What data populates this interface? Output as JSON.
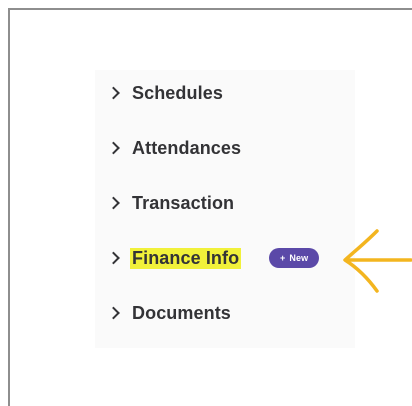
{
  "menu": {
    "items": [
      {
        "label": "Schedules",
        "icon": "chevron-right-icon"
      },
      {
        "label": "Attendances",
        "icon": "chevron-right-icon"
      },
      {
        "label": "Transaction",
        "icon": "chevron-right-icon"
      },
      {
        "label": "Finance Info",
        "icon": "chevron-right-icon",
        "highlighted": true,
        "badge": {
          "plus": "+",
          "text": "New"
        }
      },
      {
        "label": "Documents",
        "icon": "chevron-right-icon"
      }
    ]
  },
  "colors": {
    "text": "#333336",
    "highlight": "#f1f13a",
    "badge_bg": "#5b49a8",
    "arrow": "#f3b51f",
    "frame_border": "#8e8e8e"
  },
  "annotation": {
    "icon": "arrow-left-icon"
  }
}
